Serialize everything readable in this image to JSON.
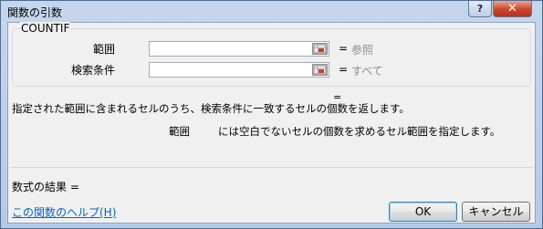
{
  "window": {
    "title": "関数の引数",
    "help_glyph": "?",
    "close_glyph": "✕"
  },
  "function": {
    "name": "COUNTIF",
    "arguments": [
      {
        "label": "範囲",
        "value": "",
        "eq": "=",
        "result": "参照"
      },
      {
        "label": "検索条件",
        "value": "",
        "eq": "=",
        "result": "すべて"
      }
    ],
    "formula_eq": "=",
    "description": "指定された範囲に含まれるセルのうち、検索条件に一致するセルの個数を返します。",
    "arg_description_name": "範囲",
    "arg_description_text": "には空白でないセルの個数を求めるセル範囲を指定します。"
  },
  "result_label": "数式の結果 =",
  "help_link": "この関数のヘルプ(H)",
  "buttons": {
    "ok": "OK",
    "cancel": "キャンセル"
  },
  "icons": {
    "ref_button": "collapse-dialog-icon",
    "help": "help-icon",
    "close": "close-icon"
  }
}
